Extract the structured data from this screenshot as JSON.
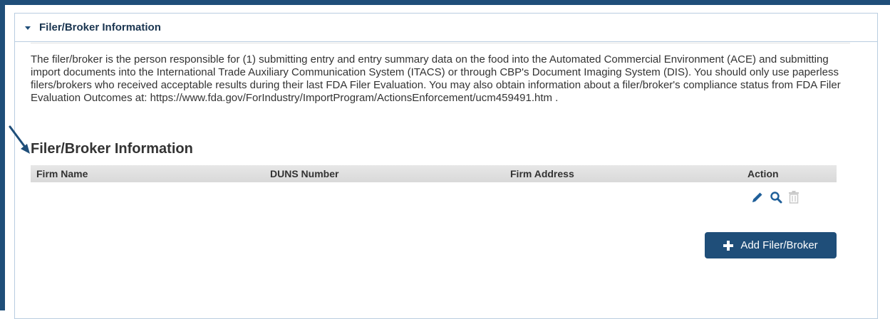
{
  "panel": {
    "header_title": "Filer/Broker Information"
  },
  "description": "The filer/broker is the person responsible for (1) submitting entry and entry summary data on the food into the Automated Commercial Environment (ACE) and submitting import documents into the International Trade Auxiliary Communication System (ITACS) or through CBP's Document Imaging System (DIS). You should only use paperless filers/brokers who received acceptable results during their last FDA Filer Evaluation. You may also obtain information about a filer/broker's compliance status from FDA Filer Evaluation Outcomes at: https://www.fda.gov/ForIndustry/ImportProgram/ActionsEnforcement/ucm459491.htm .",
  "section_heading": "Filer/Broker Information",
  "table": {
    "columns": [
      "Firm Name",
      "DUNS Number",
      "Firm Address",
      "Action"
    ]
  },
  "actions": {
    "icons": [
      "pencil-icon",
      "magnifier-icon",
      "trash-icon"
    ]
  },
  "add_button": {
    "label": "Add Filer/Broker"
  },
  "colors": {
    "frame": "#1f4e79",
    "button": "#1f4e79",
    "action_icon": "#1f5f99",
    "trash_icon": "#c8c8c8"
  }
}
